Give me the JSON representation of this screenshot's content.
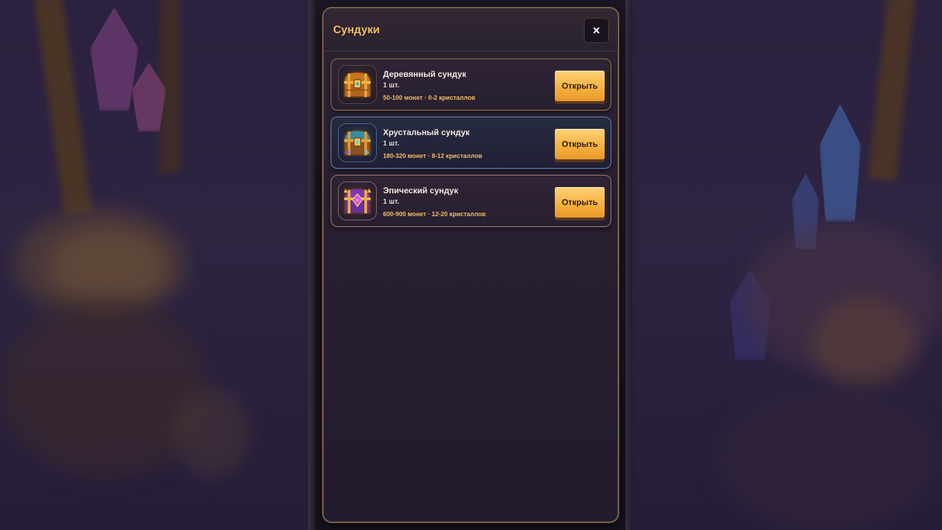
{
  "modal": {
    "title": "Сундуки",
    "close_label": "×"
  },
  "chests": [
    {
      "name": "Деревянный сундук",
      "quantity": "1 шт.",
      "rewards": "50-100 монет · 0-2 кристаллов",
      "open_label": "Открыть",
      "icon": "wooden-chest-icon",
      "accent": "#d8892a"
    },
    {
      "name": "Хрустальный сундук",
      "quantity": "1 шт.",
      "rewards": "180-320 монет · 8-12 кристаллов",
      "open_label": "Открыть",
      "icon": "crystal-chest-icon",
      "accent": "#4aa6c8"
    },
    {
      "name": "Эпический сундук",
      "quantity": "1 шт.",
      "rewards": "600-900 монет · 12-20 кристаллов",
      "open_label": "Открыть",
      "icon": "epic-chest-icon",
      "accent": "#8a3fc4"
    }
  ],
  "colors": {
    "title": "#f5c061",
    "button": "#f6b240",
    "panel_border": "#7b6248"
  }
}
